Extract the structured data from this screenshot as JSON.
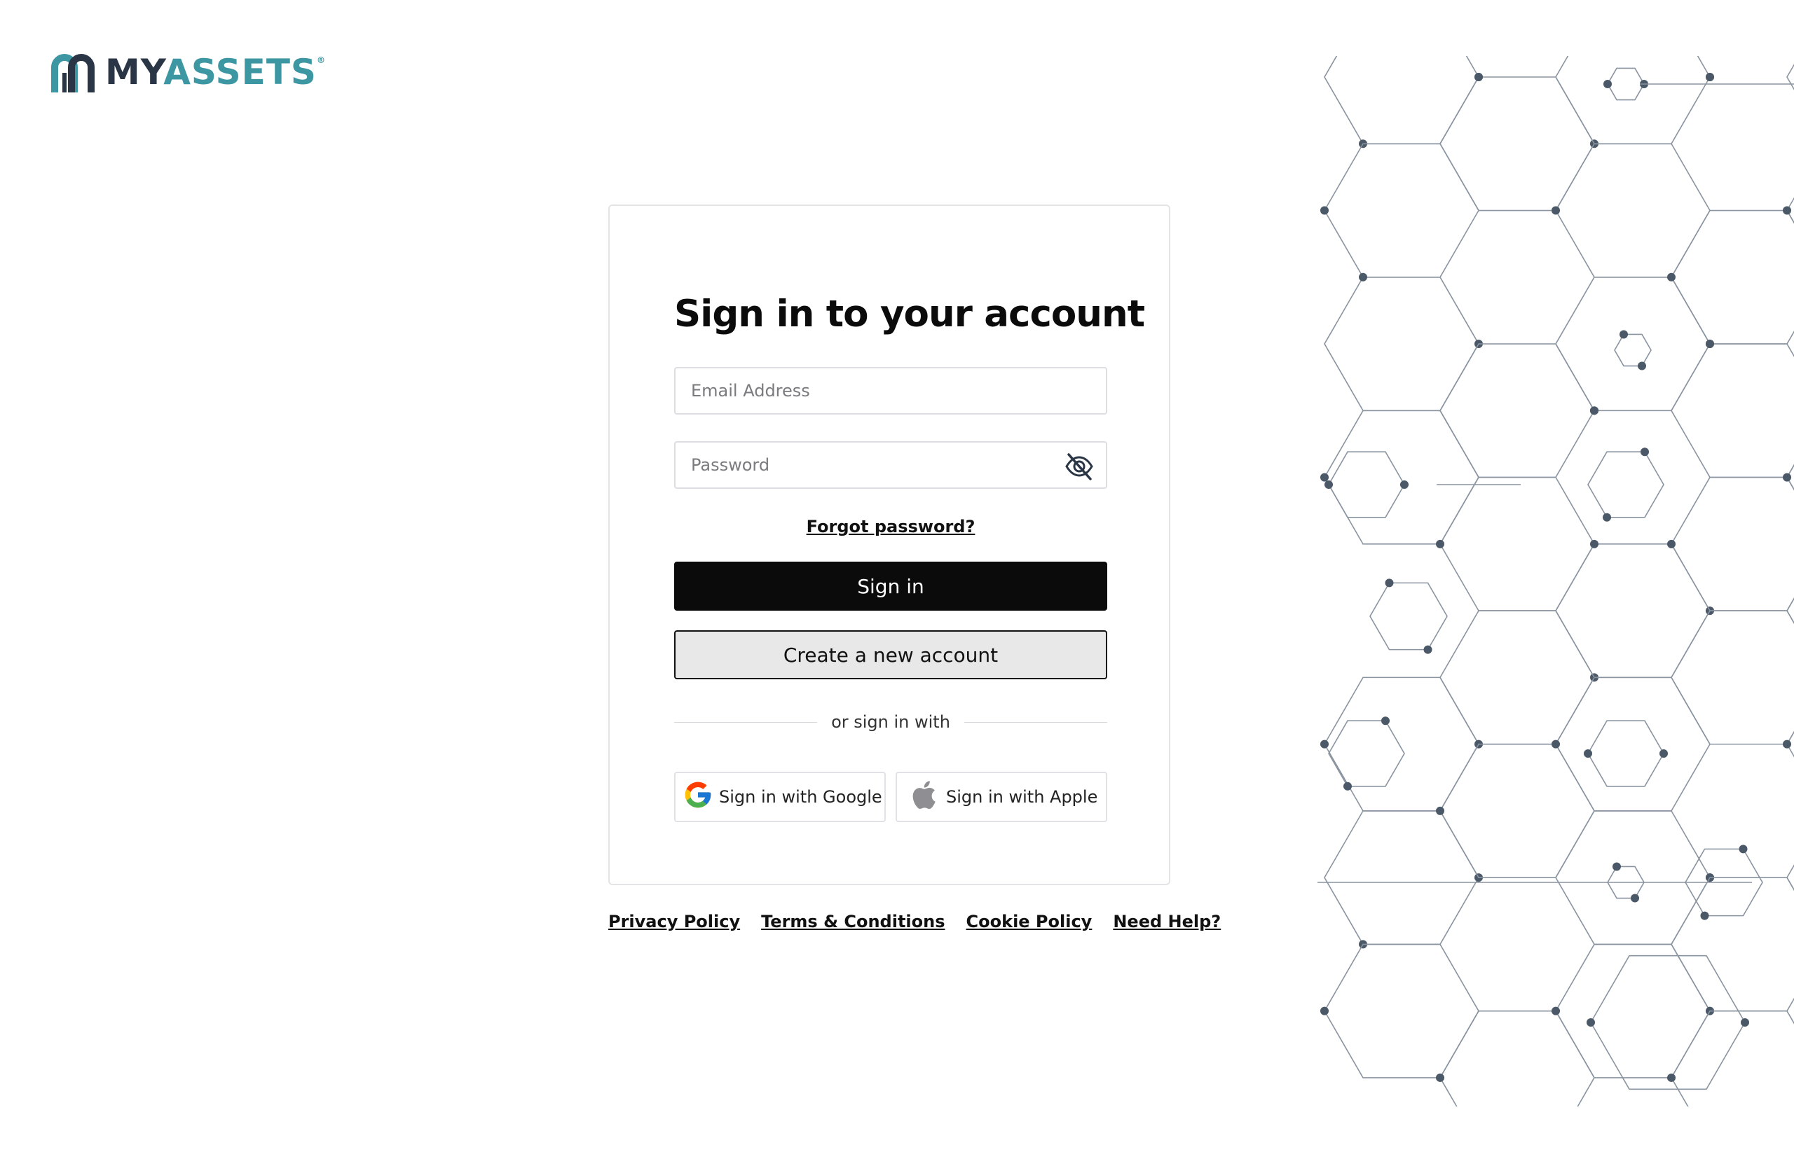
{
  "brand": {
    "name_part1": "MY",
    "name_part2": "ASSETS",
    "registered_mark": "®",
    "primary_color": "#2a3646",
    "accent_color": "#3c97a3"
  },
  "signin": {
    "title": "Sign in to your account",
    "email_placeholder": "Email Address",
    "password_placeholder": "Password",
    "toggle_visibility_icon": "eye-off-icon",
    "forgot_password": "Forgot password?",
    "signin_button": "Sign in",
    "create_account_button": "Create a new account",
    "divider_text": "or sign in with",
    "google_button": "Sign in with Google",
    "apple_button": "Sign in with Apple"
  },
  "footer": {
    "links": [
      "Privacy Policy",
      "Terms & Conditions",
      "Cookie Policy",
      "Need Help?"
    ]
  },
  "decoration": {
    "pattern": "hexagon-network",
    "line_color": "#8a94a0",
    "node_color": "#4a5867"
  }
}
